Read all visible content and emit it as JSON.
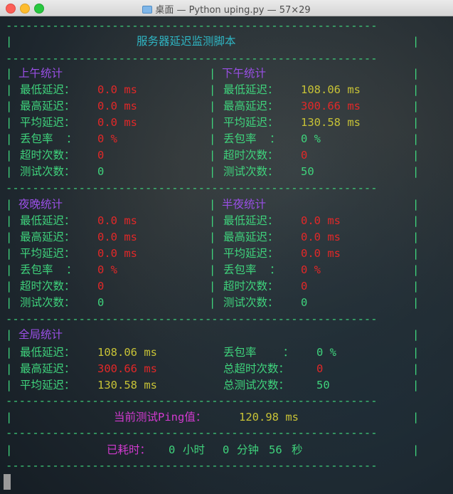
{
  "window": {
    "title": "桌面 — Python uping.py — 57×29"
  },
  "header": {
    "title": "服务器延迟监测脚本"
  },
  "morning": {
    "heading": "上午统计",
    "min_label": "最低延迟：",
    "min_value": "0.0 ms",
    "max_label": "最高延迟：",
    "max_value": "0.0 ms",
    "avg_label": "平均延迟：",
    "avg_value": "0.0 ms",
    "loss_label": "丢包率  ：",
    "loss_value": "0 %",
    "timeout_label": "超时次数：",
    "timeout_value": "0",
    "tests_label": "测试次数：",
    "tests_value": "0"
  },
  "afternoon": {
    "heading": "下午统计",
    "min_label": "最低延迟：",
    "min_value": "108.06 ms",
    "max_label": "最高延迟：",
    "max_value": "300.66 ms",
    "avg_label": "平均延迟：",
    "avg_value": "130.58 ms",
    "loss_label": "丢包率  ：",
    "loss_value": "0 %",
    "timeout_label": "超时次数：",
    "timeout_value": "0",
    "tests_label": "测试次数：",
    "tests_value": "50"
  },
  "evening": {
    "heading": "夜晚统计",
    "min_label": "最低延迟：",
    "min_value": "0.0 ms",
    "max_label": "最高延迟：",
    "max_value": "0.0 ms",
    "avg_label": "平均延迟：",
    "avg_value": "0.0 ms",
    "loss_label": "丢包率  ：",
    "loss_value": "0 %",
    "timeout_label": "超时次数：",
    "timeout_value": "0",
    "tests_label": "测试次数：",
    "tests_value": "0"
  },
  "midnight": {
    "heading": "半夜统计",
    "min_label": "最低延迟：",
    "min_value": "0.0 ms",
    "max_label": "最高延迟：",
    "max_value": "0.0 ms",
    "avg_label": "平均延迟：",
    "avg_value": "0.0 ms",
    "loss_label": "丢包率  ：",
    "loss_value": "0 %",
    "timeout_label": "超时次数：",
    "timeout_value": "0",
    "tests_label": "测试次数：",
    "tests_value": "0"
  },
  "global": {
    "heading": "全局统计",
    "min_label": "最低延迟：",
    "min_value": "108.06 ms",
    "max_label": "最高延迟：",
    "max_value": "300.66 ms",
    "avg_label": "平均延迟：",
    "avg_value": "130.58 ms",
    "loss_label": "丢包率    ：",
    "loss_value": "0 %",
    "timeout_label": "总超时次数：",
    "timeout_value": "0",
    "tests_label": "总测试次数：",
    "tests_value": "50"
  },
  "current": {
    "label": "当前测试Ping值：",
    "value": "120.98 ms"
  },
  "elapsed": {
    "label": "已耗时：",
    "hours": "0",
    "hours_unit": "小时",
    "minutes": "0",
    "minutes_unit": "分钟",
    "seconds": "56",
    "seconds_unit": "秒"
  },
  "border": {
    "dash_line": "--------------------------------------------------------",
    "pipe": "|"
  },
  "colors": {
    "green": "#3fd37c",
    "cyan": "#2fb6c4",
    "purple": "#9a4fe6",
    "red": "#e22828",
    "yellow": "#c7c236",
    "magenta": "#d23ad0"
  }
}
